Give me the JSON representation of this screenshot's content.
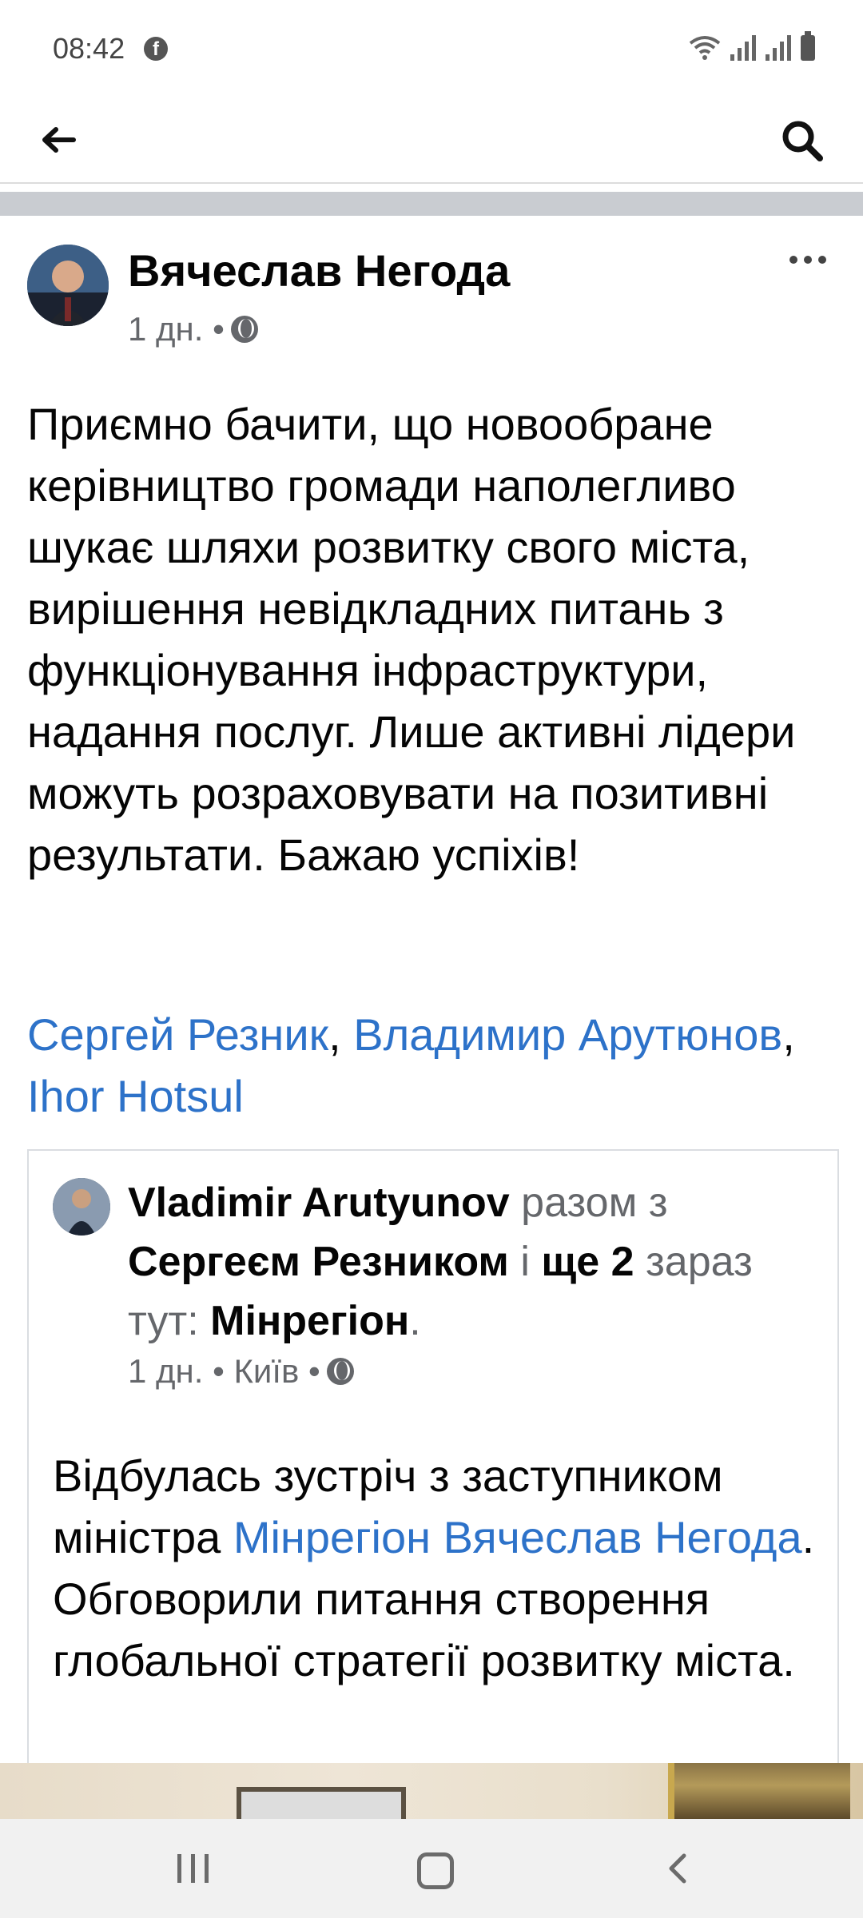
{
  "status_bar": {
    "time": "08:42"
  },
  "post": {
    "author": "Вячеслав Негода",
    "meta": "1 дн. •",
    "text": "Приємно бачити, що новообране керівництво громади наполегливо шукає шляхи розвитку свого міста, вирішення невідкладних питань з функціонування інфраструктури, надання послуг. Лише активні лідери можуть розраховувати на позитивні результати. Бажаю успіхів!",
    "mentions": [
      "Сергей Резник",
      "Владимир Арутюнов",
      "Ihor Hotsul"
    ],
    "mention_separator": ", "
  },
  "shared_post": {
    "author": "Vladimir  Arutyunov",
    "with_text": "разом з",
    "with_person": "Сергеєм Резником",
    "and_text": "і",
    "others": "ще 2",
    "location_text": "зараз тут:",
    "place": "Мінрегіон",
    "period": ".",
    "meta": "1 дн. • Київ •",
    "text_1": "Відбулась зустріч з заступником міністра ",
    "text_link": "Мінрегіон Вячеслав Негода",
    "text_2": ". Обговорили питання створення глобальної стратегії розвитку міста."
  },
  "icons": {
    "back": "back-arrow-icon",
    "search": "search-icon",
    "more": "more-options-icon",
    "audience": "globe-icon"
  },
  "colors": {
    "link": "#2d72c9",
    "meta": "#65676b",
    "divider": "#c9ccd1"
  }
}
